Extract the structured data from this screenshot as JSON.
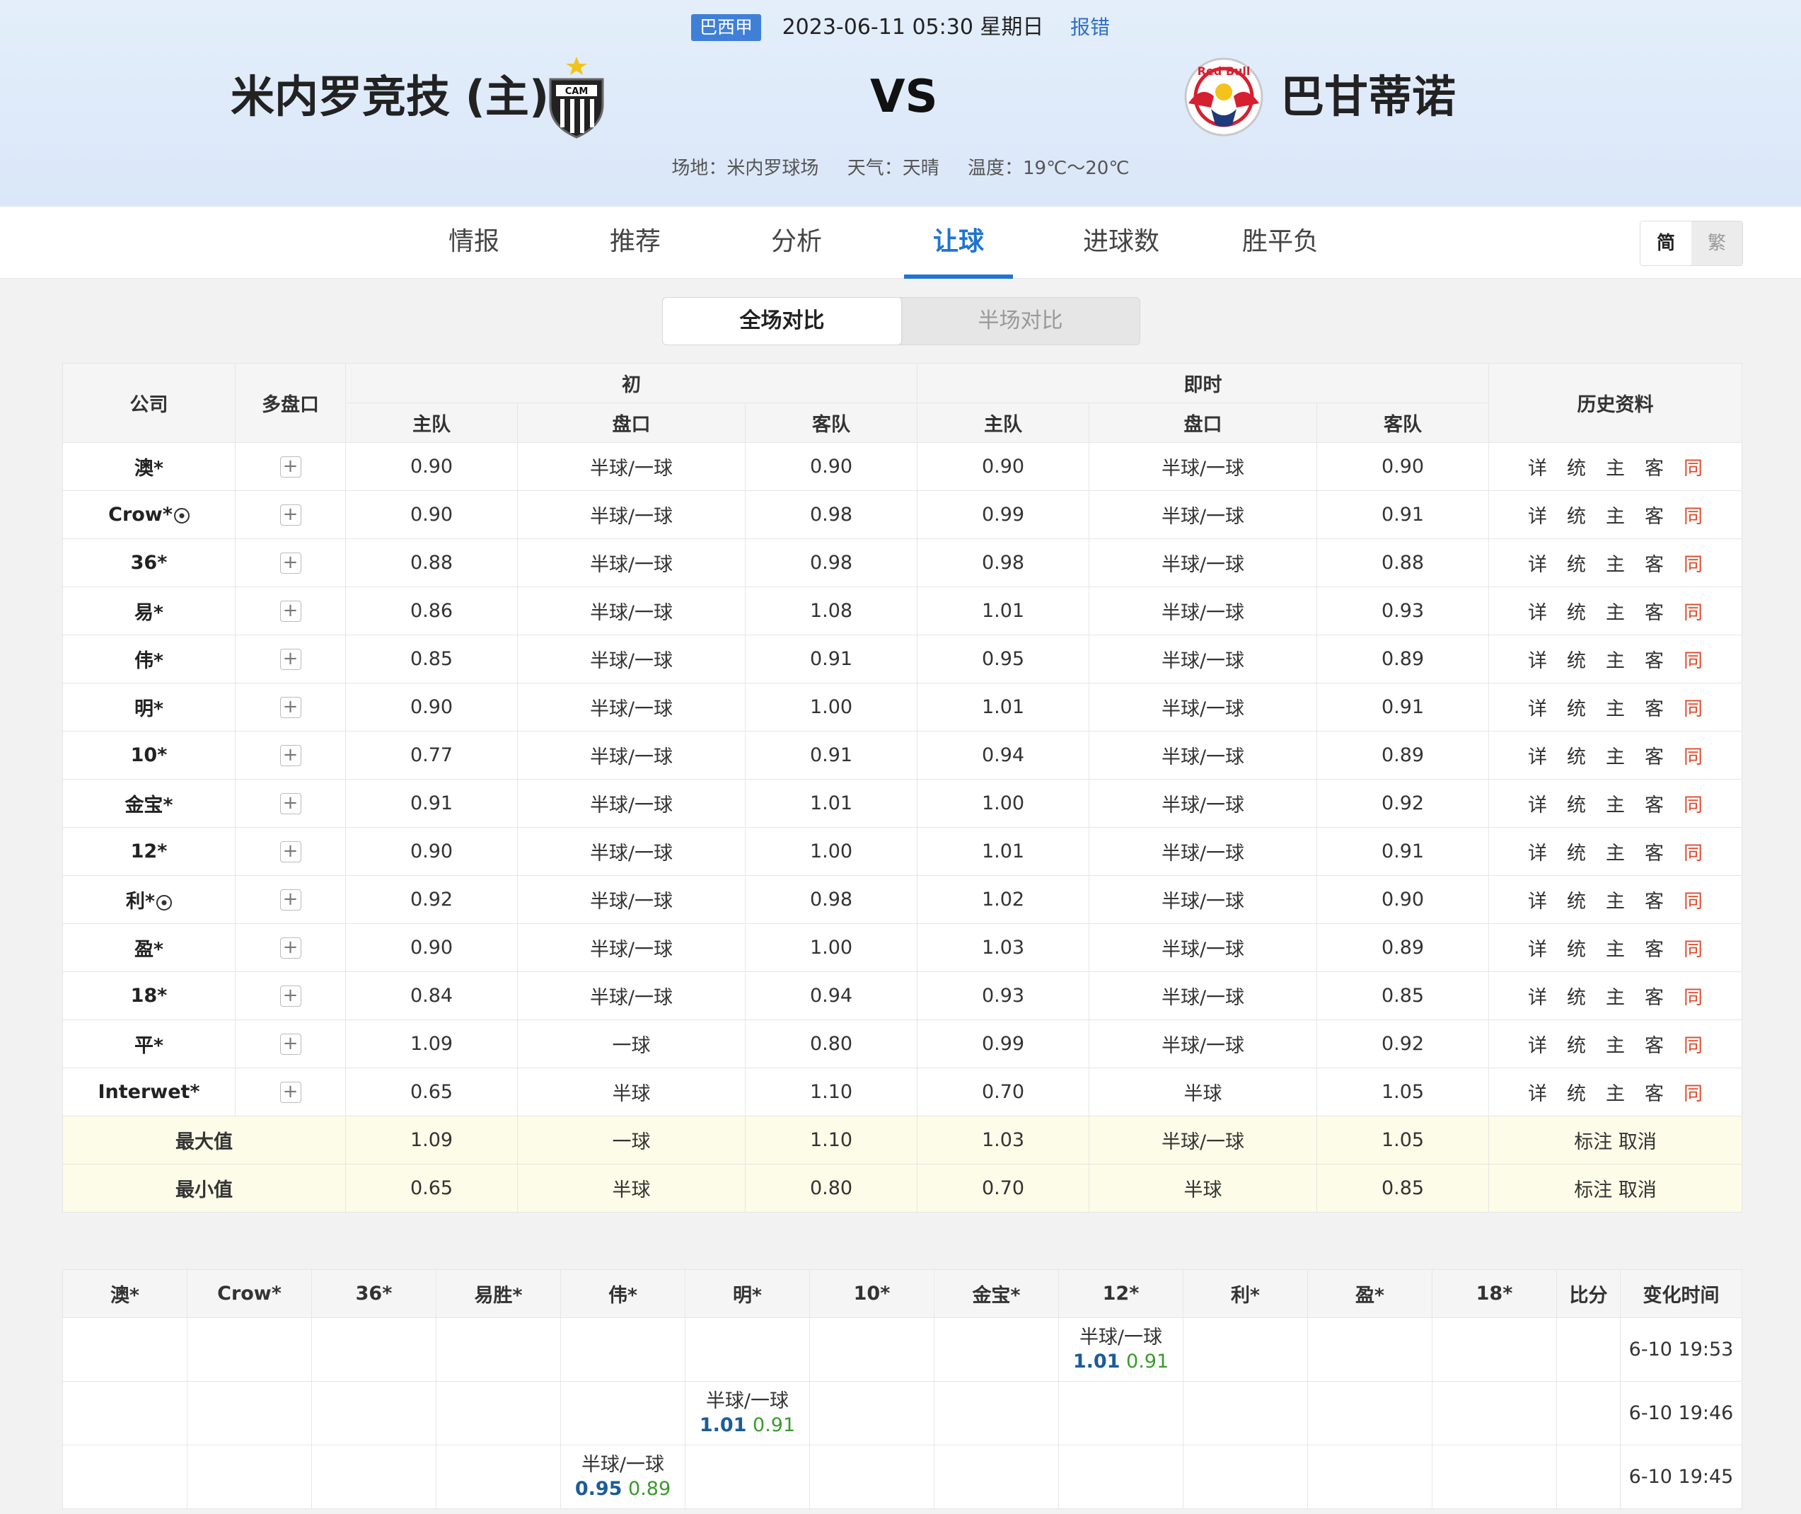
{
  "header": {
    "league": "巴西甲",
    "datetime": "2023-06-11 05:30 星期日",
    "report": "报错",
    "home_team": "米内罗竞技 (主)",
    "vs": "VS",
    "away_team": "巴甘蒂诺",
    "home_logo_text": "CAM",
    "away_logo_text": "Red Bull",
    "venue": "场地：米内罗球场",
    "weather": "天气：天晴",
    "temperature": "温度：19℃～20℃"
  },
  "tabs": [
    "情报",
    "推荐",
    "分析",
    "让球",
    "进球数",
    "胜平负"
  ],
  "active_tab": "让球",
  "lang": {
    "simplified": "简",
    "traditional": "繁"
  },
  "segment": {
    "full": "全场对比",
    "half": "半场对比"
  },
  "odds_table": {
    "headers": {
      "company": "公司",
      "multi": "多盘口",
      "initial": "初",
      "live": "即时",
      "history": "历史资料",
      "home": "主队",
      "line": "盘口",
      "away": "客队"
    },
    "history_links": [
      "详",
      "统",
      "主",
      "客",
      "同"
    ],
    "rows": [
      {
        "company": "澳*",
        "ball": false,
        "i_home": "0.90",
        "i_line": "半球/一球",
        "i_away": "0.90",
        "l_home": "0.90",
        "l_line": "半球/一球",
        "l_away": "0.90"
      },
      {
        "company": "Crow*",
        "ball": true,
        "i_home": "0.90",
        "i_line": "半球/一球",
        "i_away": "0.98",
        "l_home": "0.99",
        "l_line": "半球/一球",
        "l_away": "0.91"
      },
      {
        "company": "36*",
        "ball": false,
        "i_home": "0.88",
        "i_line": "半球/一球",
        "i_away": "0.98",
        "l_home": "0.98",
        "l_line": "半球/一球",
        "l_away": "0.88"
      },
      {
        "company": "易*",
        "ball": false,
        "i_home": "0.86",
        "i_line": "半球/一球",
        "i_away": "1.08",
        "l_home": "1.01",
        "l_line": "半球/一球",
        "l_away": "0.93"
      },
      {
        "company": "伟*",
        "ball": false,
        "i_home": "0.85",
        "i_line": "半球/一球",
        "i_away": "0.91",
        "l_home": "0.95",
        "l_line": "半球/一球",
        "l_away": "0.89"
      },
      {
        "company": "明*",
        "ball": false,
        "i_home": "0.90",
        "i_line": "半球/一球",
        "i_away": "1.00",
        "l_home": "1.01",
        "l_line": "半球/一球",
        "l_away": "0.91"
      },
      {
        "company": "10*",
        "ball": false,
        "i_home": "0.77",
        "i_line": "半球/一球",
        "i_away": "0.91",
        "l_home": "0.94",
        "l_line": "半球/一球",
        "l_away": "0.89"
      },
      {
        "company": "金宝*",
        "ball": false,
        "i_home": "0.91",
        "i_line": "半球/一球",
        "i_away": "1.01",
        "l_home": "1.00",
        "l_line": "半球/一球",
        "l_away": "0.92"
      },
      {
        "company": "12*",
        "ball": false,
        "i_home": "0.90",
        "i_line": "半球/一球",
        "i_away": "1.00",
        "l_home": "1.01",
        "l_line": "半球/一球",
        "l_away": "0.91"
      },
      {
        "company": "利*",
        "ball": true,
        "i_home": "0.92",
        "i_line": "半球/一球",
        "i_away": "0.98",
        "l_home": "1.02",
        "l_line": "半球/一球",
        "l_away": "0.90"
      },
      {
        "company": "盈*",
        "ball": false,
        "i_home": "0.90",
        "i_line": "半球/一球",
        "i_away": "1.00",
        "l_home": "1.03",
        "l_line": "半球/一球",
        "l_away": "0.89"
      },
      {
        "company": "18*",
        "ball": false,
        "i_home": "0.84",
        "i_line": "半球/一球",
        "i_away": "0.94",
        "l_home": "0.93",
        "l_line": "半球/一球",
        "l_away": "0.85"
      },
      {
        "company": "平*",
        "ball": false,
        "i_home": "1.09",
        "i_line": "一球",
        "i_away": "0.80",
        "l_home": "0.99",
        "l_line": "半球/一球",
        "l_away": "0.92"
      },
      {
        "company": "Interwet*",
        "ball": false,
        "i_home": "0.65",
        "i_line": "半球",
        "i_away": "1.10",
        "l_home": "0.70",
        "l_line": "半球",
        "l_away": "1.05"
      }
    ],
    "max": {
      "label": "最大值",
      "i_home": "1.09",
      "i_line": "一球",
      "i_away": "1.10",
      "l_home": "1.03",
      "l_line": "半球/一球",
      "l_away": "1.05",
      "mark": "标注",
      "cancel": "取消"
    },
    "min": {
      "label": "最小值",
      "i_home": "0.65",
      "i_line": "半球",
      "i_away": "0.80",
      "l_home": "0.70",
      "l_line": "半球",
      "l_away": "0.85",
      "mark": "标注",
      "cancel": "取消"
    }
  },
  "change_table": {
    "headers": [
      "澳*",
      "Crow*",
      "36*",
      "易胜*",
      "伟*",
      "明*",
      "10*",
      "金宝*",
      "12*",
      "利*",
      "盈*",
      "18*",
      "比分",
      "变化时间"
    ],
    "rows": [
      {
        "col": 8,
        "line": "半球/一球",
        "home": "1.01",
        "away": "0.91",
        "time": "6-10 19:53"
      },
      {
        "col": 5,
        "line": "半球/一球",
        "home": "1.01",
        "away": "0.91",
        "time": "6-10 19:46"
      },
      {
        "col": 4,
        "line": "半球/一球",
        "home": "0.95",
        "away": "0.89",
        "time": "6-10 19:45"
      }
    ]
  }
}
